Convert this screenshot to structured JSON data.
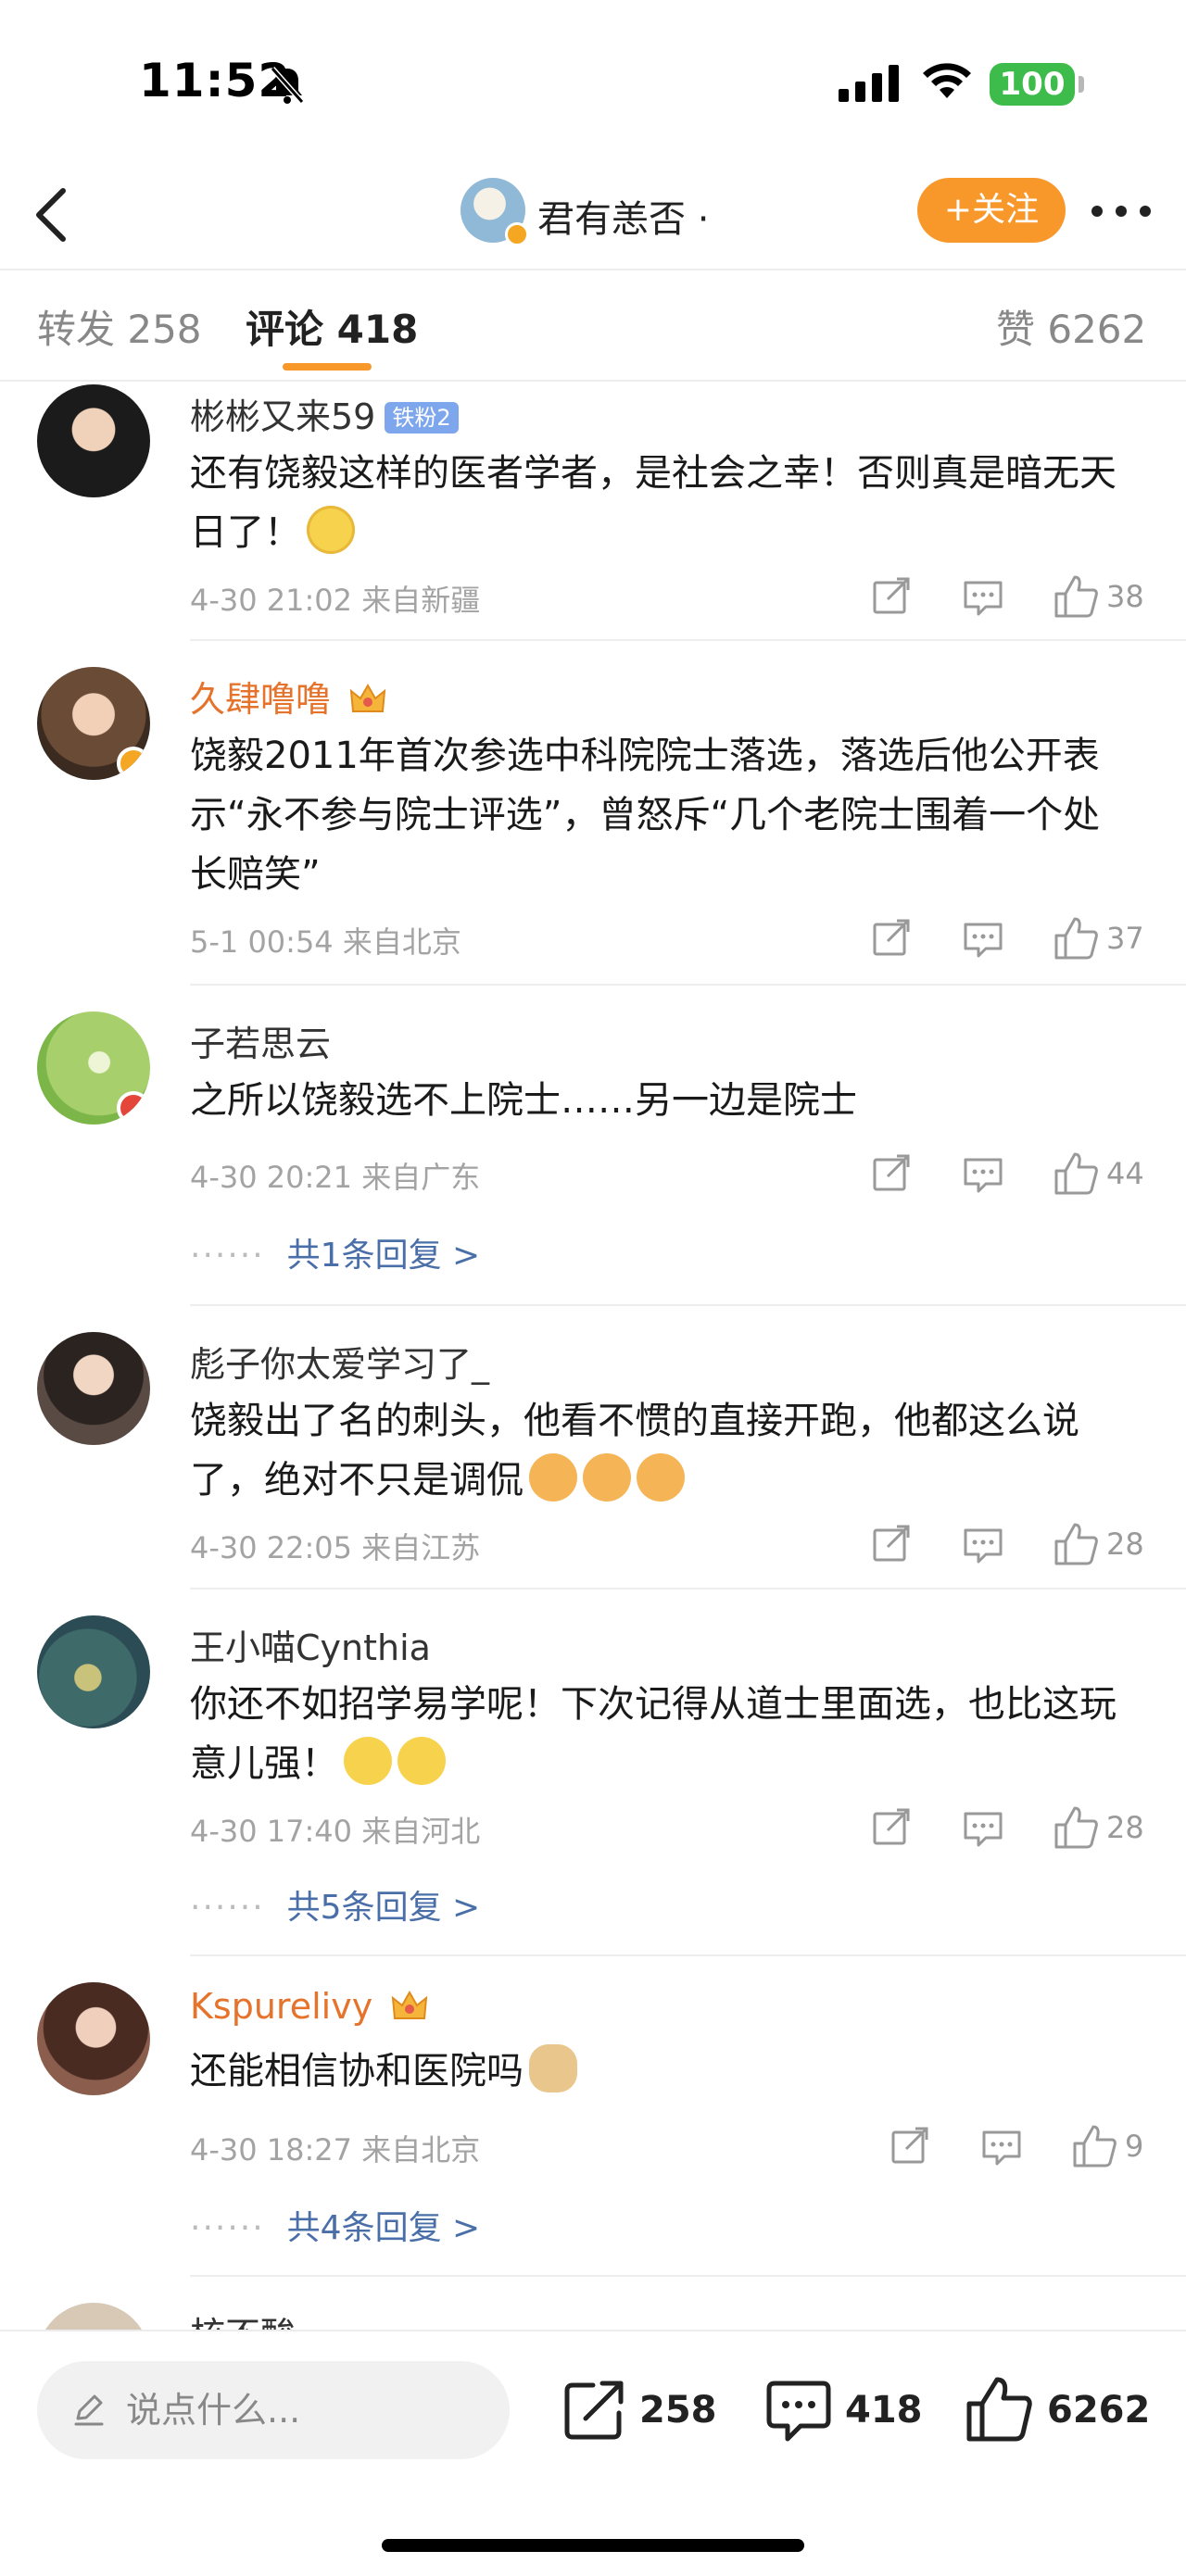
{
  "status_bar": {
    "time": "11:52",
    "battery": "100"
  },
  "nav": {
    "title": "君有恙否 ·",
    "follow_label": "+关注"
  },
  "tabs": {
    "repost": "转发 258",
    "comments": "评论 418",
    "likes": "赞 6262"
  },
  "comments": [
    {
      "username": "彬彬又来59",
      "fan_badge": "铁粉2",
      "text": "还有饶毅这样的医者学者，是社会之幸！否则真是暗无天日了！",
      "meta": "4-30 21:02 来自新疆",
      "likes": "38",
      "replies": ""
    },
    {
      "username": "久肆噜噜",
      "text": "饶毅2011年首次参选中科院院士落选，落选后他公开表示“永不参与院士评选”，曾怒斥“几个老院士围着一个处长赔笑”",
      "meta": "5-1 00:54 来自北京",
      "likes": "37",
      "replies": ""
    },
    {
      "username": "子若思云",
      "text": "之所以饶毅选不上院士……另一边是院士",
      "meta": "4-30 20:21 来自广东",
      "likes": "44",
      "replies": "共1条回复 >"
    },
    {
      "username": "彪子你太爱学习了_",
      "text": "饶毅出了名的刺头，他看不惯的直接开跑，他都这么说了，绝对不只是调侃",
      "meta": "4-30 22:05 来自江苏",
      "likes": "28",
      "replies": ""
    },
    {
      "username": "王小喵Cynthia",
      "text": "你还不如招学易学呢！下次记得从道士里面选，也比这玩意儿强！",
      "meta": "4-30 17:40 来自河北",
      "likes": "28",
      "replies": "共5条回复 >"
    },
    {
      "username": "Kspurelivy",
      "text": "还能相信协和医院吗",
      "meta": "4-30 18:27 来自北京",
      "likes": "9",
      "replies": "共4条回复 >"
    },
    {
      "username": "核不酸"
    }
  ],
  "bottom_bar": {
    "placeholder": "说点什么...",
    "reposts": "258",
    "comments": "418",
    "likes": "6262"
  },
  "colors": {
    "accent": "#f8982b",
    "link": "#4a6fa8",
    "username_vip": "#e5732b"
  },
  "icons": [
    "bell-slash-icon",
    "signal-icon",
    "wifi-icon",
    "back-icon",
    "more-icon",
    "share-icon",
    "comment-icon",
    "like-icon",
    "pen-icon",
    "crown-icon"
  ]
}
